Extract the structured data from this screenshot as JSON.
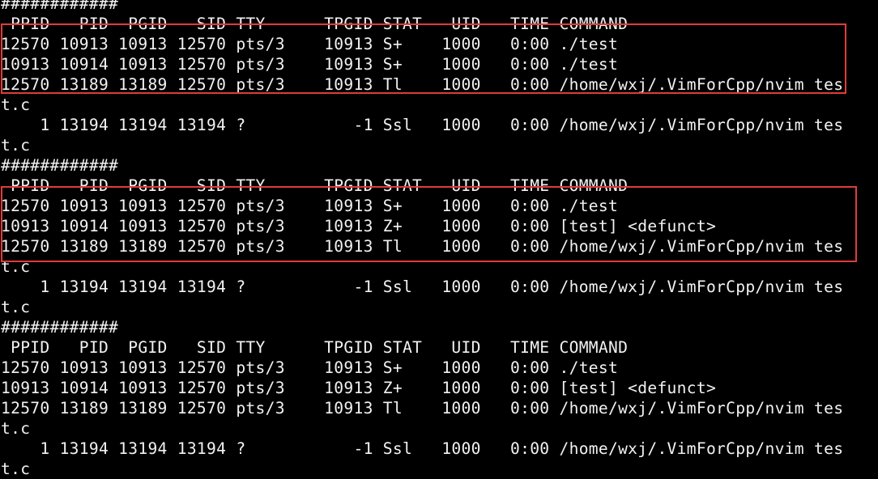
{
  "terminal": {
    "lines": [
      "############",
      " PPID   PID  PGID   SID TTY      TPGID STAT   UID   TIME COMMAND",
      "12570 10913 10913 12570 pts/3    10913 S+    1000   0:00 ./test",
      "10913 10914 10913 12570 pts/3    10913 S+    1000   0:00 ./test",
      "12570 13189 13189 12570 pts/3    10913 Tl    1000   0:00 /home/wxj/.VimForCpp/nvim tes",
      "t.c",
      "    1 13194 13194 13194 ?           -1 Ssl   1000   0:00 /home/wxj/.VimForCpp/nvim tes",
      "t.c",
      "############",
      " PPID   PID  PGID   SID TTY      TPGID STAT   UID   TIME COMMAND",
      "12570 10913 10913 12570 pts/3    10913 S+    1000   0:00 ./test",
      "10913 10914 10913 12570 pts/3    10913 Z+    1000   0:00 [test] <defunct>",
      "12570 13189 13189 12570 pts/3    10913 Tl    1000   0:00 /home/wxj/.VimForCpp/nvim tes",
      "t.c",
      "    1 13194 13194 13194 ?           -1 Ssl   1000   0:00 /home/wxj/.VimForCpp/nvim tes",
      "t.c",
      "############",
      " PPID   PID  PGID   SID TTY      TPGID STAT   UID   TIME COMMAND",
      "12570 10913 10913 12570 pts/3    10913 S+    1000   0:00 ./test",
      "10913 10914 10913 12570 pts/3    10913 Z+    1000   0:00 [test] <defunct>",
      "12570 13189 13189 12570 pts/3    10913 Tl    1000   0:00 /home/wxj/.VimForCpp/nvim tes",
      "t.c",
      "    1 13194 13194 13194 ?           -1 Ssl   1000   0:00 /home/wxj/.VimForCpp/nvim tes",
      "t.c"
    ]
  },
  "colors": {
    "background": "#000000",
    "text": "#f2f2f2",
    "highlight_box": "#e03b3b"
  }
}
